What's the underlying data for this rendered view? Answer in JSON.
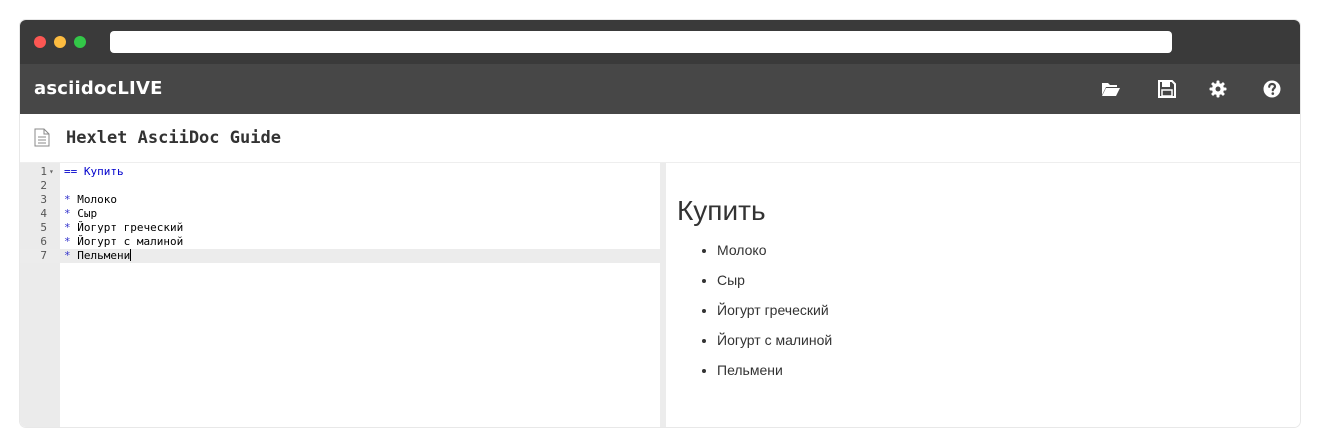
{
  "app": {
    "brand": "asciidocLIVE",
    "colors": {
      "header_bg": "#474747",
      "browser_bar": "#3a3a3a",
      "heading_token": "#0000cc"
    }
  },
  "toolbar": {
    "icons": [
      "folder-open-icon",
      "save-icon",
      "gear-icon",
      "help-icon"
    ]
  },
  "document": {
    "title": "Hexlet AsciiDoc Guide"
  },
  "editor": {
    "lines": [
      {
        "number": "1",
        "marker": "==",
        "text": " Купить"
      },
      {
        "number": "2",
        "marker": "",
        "text": ""
      },
      {
        "number": "3",
        "marker": "*",
        "text": " Молоко"
      },
      {
        "number": "4",
        "marker": "*",
        "text": " Сыр"
      },
      {
        "number": "5",
        "marker": "*",
        "text": " Йогурт греческий"
      },
      {
        "number": "6",
        "marker": "*",
        "text": " Йогурт с малиной"
      },
      {
        "number": "7",
        "marker": "*",
        "text": " Пельмени"
      }
    ],
    "active_line": "7"
  },
  "preview": {
    "heading": "Купить",
    "items": [
      "Молоко",
      "Сыр",
      "Йогурт греческий",
      "Йогурт с малиной",
      "Пельмени"
    ]
  }
}
